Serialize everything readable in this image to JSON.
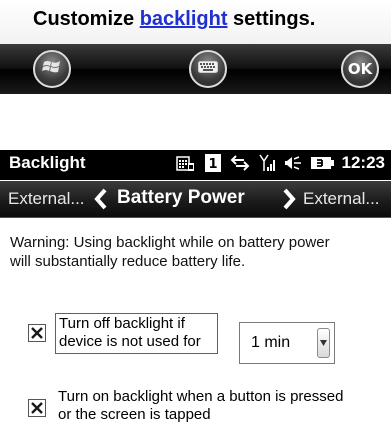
{
  "help_strip": {
    "text_before": "Customize ",
    "link": "backlight",
    "text_after": " settings."
  },
  "softkeys": {
    "start_icon": "windows-start-icon",
    "keyboard_icon": "keyboard-icon",
    "ok_label": "OK"
  },
  "title_bar": {
    "title": "Backlight",
    "clock": "12:23",
    "status_icons": [
      "phone-keypad-icon",
      "notification-count-icon",
      "sync-arrows-icon",
      "signal-strength-icon",
      "volume-icon",
      "battery-icon"
    ],
    "notification_count": "1"
  },
  "nav": {
    "prev_label": "External...",
    "current": "Battery Power",
    "next_label": "External..."
  },
  "warning": "Warning: Using backlight while on battery power will substantially reduce battery life.",
  "options": {
    "turn_off": {
      "label": "Turn off backlight if device is not used for",
      "checked": true
    },
    "timeout": {
      "value": "1 min"
    },
    "turn_on": {
      "label": "Turn on backlight when a button is pressed or the screen is tapped",
      "checked": true
    }
  },
  "colors": {
    "link": "#1f2fd1",
    "title_bar_bg": "#000000",
    "focus_border": "#3a5fcd"
  }
}
